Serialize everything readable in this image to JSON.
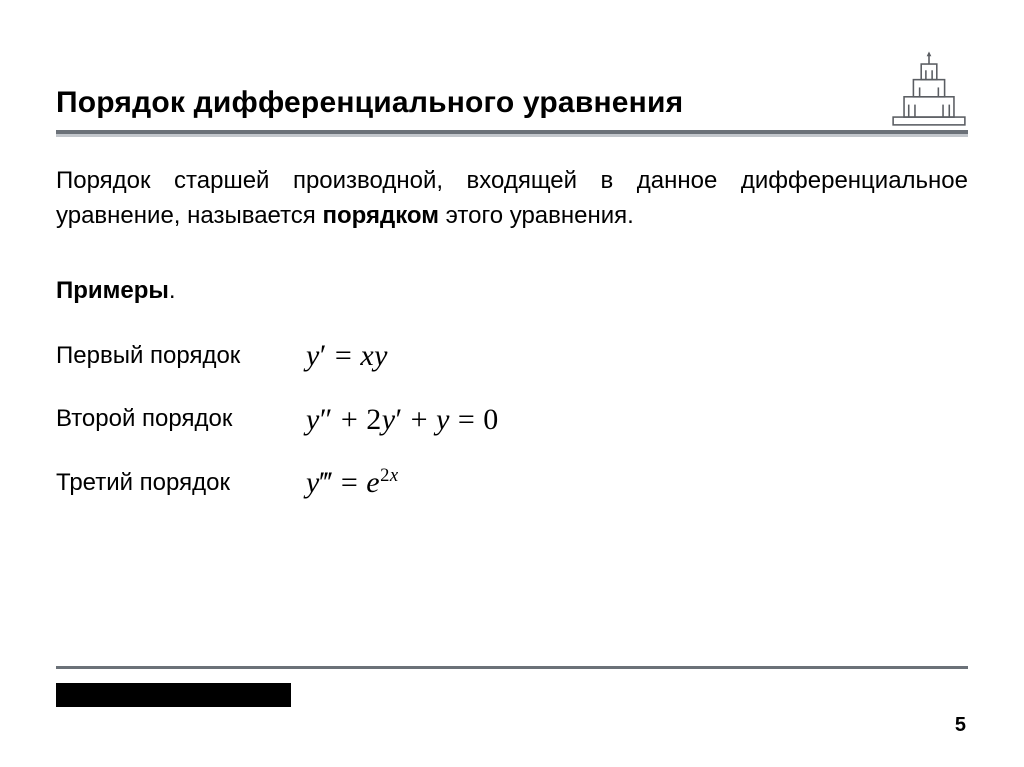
{
  "header": {
    "title": "Порядок дифференциального уравнения"
  },
  "body": {
    "definition_pre": "Порядок старшей производной, входящей в данное дифференциальное уравнение, называется ",
    "definition_bold": "порядком",
    "definition_post": " этого уравнения.",
    "examples_label": "Примеры",
    "examples_dot": "."
  },
  "examples": [
    {
      "label": "Первый порядок",
      "formula_key": "first"
    },
    {
      "label": "Второй порядок",
      "formula_key": "second"
    },
    {
      "label": "Третий порядок",
      "formula_key": "third"
    }
  ],
  "formulas": {
    "first": "y′ = xy",
    "second": "y″ + 2y′ + y = 0",
    "third_base": "y‴ = e",
    "third_exp": "2x"
  },
  "footer": {
    "page": "5"
  }
}
